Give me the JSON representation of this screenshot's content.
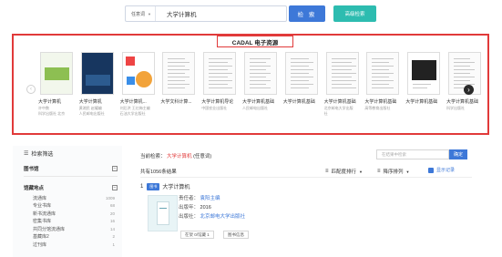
{
  "search": {
    "scope": "任意词",
    "query": "大学计算机",
    "search_button": "检 索",
    "advanced_button": "高级检索"
  },
  "cadal": {
    "title": "CADAL 电子资源",
    "books": [
      {
        "title": "大学计算机",
        "sub1": "许中数",
        "sub2": "科学出版社 北京",
        "cover": "green"
      },
      {
        "title": "大学计算机",
        "sub1": "黄湘民 赵耀编",
        "sub2": "人民邮电出版社",
        "cover": "navy"
      },
      {
        "title": "大学计算机...",
        "sub1": "刘后洪 王红梅主编",
        "sub2": "石油大学出版社",
        "cover": "colorful"
      },
      {
        "title": "大学文科计算...",
        "sub1": "",
        "sub2": "",
        "cover": "plain"
      },
      {
        "title": "大学计算机导论",
        "sub1": "中国农业出版社",
        "sub2": "",
        "cover": "doc"
      },
      {
        "title": "大学计算机基础",
        "sub1": "人民邮电出版社",
        "sub2": "",
        "cover": "doc"
      },
      {
        "title": "大学计算机基础",
        "sub1": "",
        "sub2": "",
        "cover": "doc"
      },
      {
        "title": "大学计算机基础",
        "sub1": "北京邮电大学出版",
        "sub2": "社",
        "cover": "doc"
      },
      {
        "title": "大学计算机基础",
        "sub1": "高等教育出版社",
        "sub2": "",
        "cover": "doc"
      },
      {
        "title": "大学计算机基础",
        "sub1": "",
        "sub2": "",
        "cover": "dark"
      },
      {
        "title": "大学计算机基础",
        "sub1": "科学出版社",
        "sub2": "",
        "cover": "doc"
      }
    ]
  },
  "facets": {
    "header": "检索筛选",
    "group1": "图书馆",
    "group2": "馆藏地点",
    "items": [
      {
        "label": "流通库",
        "count": "1009"
      },
      {
        "label": "专业书库",
        "count": "68"
      },
      {
        "label": "新书流通库",
        "count": "20"
      },
      {
        "label": "密集书库",
        "count": "16"
      },
      {
        "label": "共同分馆流通库",
        "count": "14"
      },
      {
        "label": "基藏库2",
        "count": "2"
      },
      {
        "label": "过刊库",
        "count": "1"
      }
    ]
  },
  "results": {
    "current_label": "当前检索：",
    "current_query": "大学计算机",
    "current_suffix": "(任意词)",
    "filter_placeholder": "在结果中检索",
    "confirm_button": "确定",
    "count_text": "共有1056条结果",
    "sort_relevance": "匹配度排行",
    "sort_order": "降序排列",
    "checkbox_label": "显示记录",
    "record": {
      "number": "1",
      "tag": "图书",
      "title": "大学计算机",
      "author_label": "责任者：",
      "author": "袁阳主编",
      "year_label": "出版年：",
      "year": "2016",
      "publisher_label": "出版社：",
      "publisher": "北京邮电大学出版社",
      "holding_button": "在架 0/馆藏 1",
      "info_button": "图书信息"
    }
  }
}
